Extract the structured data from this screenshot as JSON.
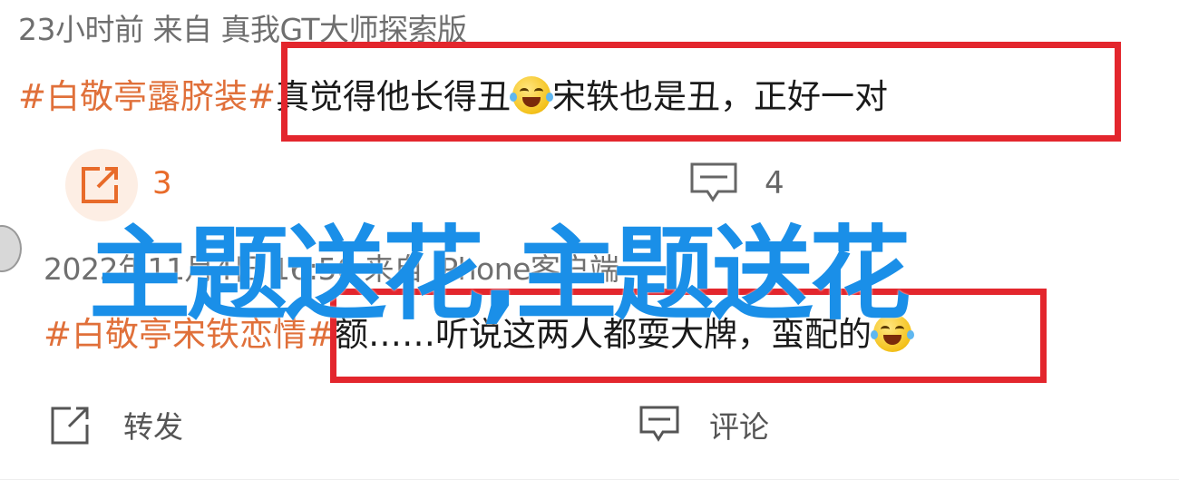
{
  "post1": {
    "meta": "23小时前 来自 真我GT大师探索版",
    "hashtag": "#白敬亭露脐装#",
    "text_before_emoji": "真觉得他长得丑",
    "emoji": "laughing-crying-face",
    "text_after_emoji": "宋轶也是丑，正好一对",
    "repost_count": "3",
    "comment_count": "4"
  },
  "post2": {
    "meta": "2022年11月4日 16:56 来自 iPhone客户端",
    "hashtag": "#白敬亭宋铁恋情#",
    "text": "额……听说这两人都耍大牌，蛮配的",
    "emoji": "laughing-crying-face",
    "repost_label": "转发",
    "comment_label": "评论"
  },
  "overlay": {
    "text": "主题送花,主题送花",
    "color": "#1a8fe8"
  },
  "colors": {
    "highlight_box": "#e3262d",
    "hashtag": "#e0703a",
    "count_accent": "#e86b2a"
  }
}
